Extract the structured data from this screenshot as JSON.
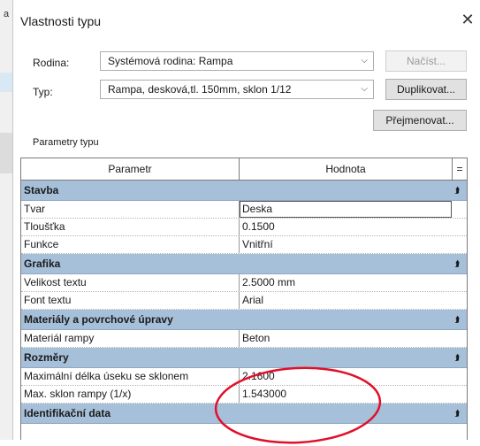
{
  "background": {
    "label": "a"
  },
  "dialog": {
    "title": "Vlastnosti typu",
    "close_symbol": "✕",
    "family_label": "Rodina:",
    "family_value": "Systémová rodina: Rampa",
    "type_label": "Typ:",
    "type_value": "Rampa, desková,tl. 150mm, sklon 1/12",
    "load_button": "Načíst...",
    "duplicate_button": "Duplikovat...",
    "rename_button": "Přejmenovat...",
    "params_caption": "Parametry typu"
  },
  "grid": {
    "header": {
      "param": "Parametr",
      "value": "Hodnota",
      "extra": "="
    },
    "groups": [
      {
        "name": "Stavba",
        "rows": [
          {
            "param": "Tvar",
            "value": "Deska"
          },
          {
            "param": "Tloušťka",
            "value": "0.1500"
          },
          {
            "param": "Funkce",
            "value": "Vnitřní"
          }
        ]
      },
      {
        "name": "Grafika",
        "rows": [
          {
            "param": "Velikost textu",
            "value": "2.5000 mm"
          },
          {
            "param": "Font textu",
            "value": "Arial"
          }
        ]
      },
      {
        "name": "Materiály a povrchové úpravy",
        "rows": [
          {
            "param": "Materiál rampy",
            "value": "Beton"
          }
        ]
      },
      {
        "name": "Rozměry",
        "rows": [
          {
            "param": "Maximální délka úseku se sklonem",
            "value": "2.1600"
          },
          {
            "param": "Max. sklon rampy (1/x)",
            "value": "1.543000"
          }
        ]
      },
      {
        "name": "Identifikační data",
        "rows": []
      }
    ]
  },
  "colors": {
    "group_header": "#a7c0da",
    "annotation": "#e0102a"
  },
  "icons": {
    "dropdown": "chevron-down-icon",
    "collapse": "collapse-chevron-icon",
    "close": "close-icon"
  }
}
